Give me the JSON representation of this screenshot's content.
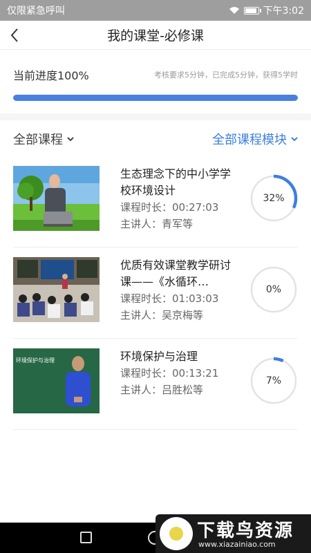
{
  "status_bar": {
    "carrier": "仅限紧急呼叫",
    "time": "下午3:02"
  },
  "header": {
    "title": "我的课堂-必修课"
  },
  "progress": {
    "title": "当前进度100%",
    "note": "考核要求5分钟，已完成5分钟，获得5学时",
    "value": 100
  },
  "filters": {
    "left": "全部课程",
    "right": "全部课程模块"
  },
  "courses": [
    {
      "title": "生态理念下的中小学学校环境设计",
      "duration": "课程时长：00:27:03",
      "speaker": "主讲人：青军等",
      "percent_label": "32%",
      "percent": 32
    },
    {
      "title": "优质有效课堂教学研讨课——《水循环…",
      "duration": "课程时长：01:03:03",
      "speaker": "主讲人：吴京梅等",
      "percent_label": "0%",
      "percent": 0
    },
    {
      "title": " 环境保护与治理",
      "duration": "课程时长：00:13:21",
      "speaker": "主讲人：吕胜松等",
      "percent_label": "7%",
      "percent": 7
    }
  ],
  "thumb_texts": {
    "course3_board": "环境保护与治理"
  },
  "watermark": {
    "title": "下载鸟资源",
    "url": "www.xiazainiao.com"
  },
  "colors": {
    "accent": "#4a7fe0",
    "ring_track": "#e3e3e3",
    "ring_fill": "#3d7fe0"
  },
  "icons": {
    "back": "chevron-left-icon",
    "dropdown": "chevron-down-icon",
    "wifi": "wifi-icon",
    "battery": "battery-icon"
  }
}
